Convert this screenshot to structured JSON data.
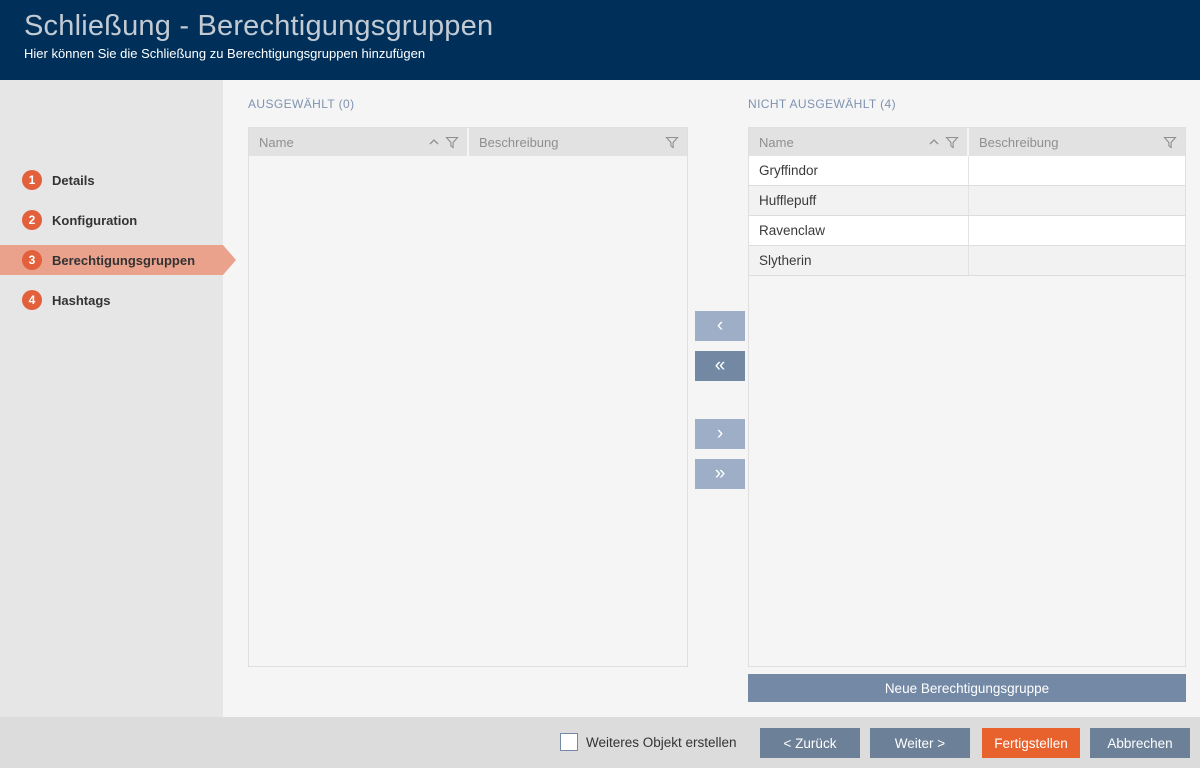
{
  "header": {
    "title": "Schließung - Berechtigungsgruppen",
    "subtitle": "Hier können Sie die Schließung zu Berechtigungsgruppen hinzufügen"
  },
  "sidebar": {
    "items": [
      {
        "number": "1",
        "label": "Details",
        "active": false
      },
      {
        "number": "2",
        "label": "Konfiguration",
        "active": false
      },
      {
        "number": "3",
        "label": "Berechtigungsgruppen",
        "active": true
      },
      {
        "number": "4",
        "label": "Hashtags",
        "active": false
      }
    ]
  },
  "selected_panel": {
    "title": "AUSGEWÄHLT (0)",
    "columns": {
      "name": "Name",
      "description": "Beschreibung"
    },
    "rows": []
  },
  "unselected_panel": {
    "title": "NICHT AUSGEWÄHLT (4)",
    "columns": {
      "name": "Name",
      "description": "Beschreibung"
    },
    "rows": [
      {
        "name": "Gryffindor",
        "beschreibung": ""
      },
      {
        "name": "Hufflepuff",
        "beschreibung": ""
      },
      {
        "name": "Ravenclaw",
        "beschreibung": ""
      },
      {
        "name": "Slytherin",
        "beschreibung": ""
      }
    ],
    "new_group_button": "Neue Berechtigungsgruppe"
  },
  "transfer": {
    "move_left_glyph": "‹",
    "move_all_left_glyph": "«",
    "move_right_glyph": "›",
    "move_all_right_glyph": "»"
  },
  "footer": {
    "checkbox_label": "Weiteres Objekt erstellen",
    "checkbox_checked": false,
    "back_label": "< Zurück",
    "next_label": "Weiter >",
    "finish_label": "Fertigstellen",
    "cancel_label": "Abbrechen"
  },
  "colors": {
    "header_bg": "#00305A",
    "title_text": "#C2CAD3",
    "sidebar_bg": "#E6E6E6",
    "content_bg": "#F5F5F5",
    "footer_bg": "#DCDCDC",
    "step_circle": "#E2603B",
    "active_step_bg": "#EAA28D",
    "accent_orange": "#E8622D",
    "button_blue": "#6C8098",
    "new_group_btn": "#7389A6",
    "transfer_light": "#9DAEC6",
    "transfer_dark": "#7288A3",
    "table_header_bg": "#E2E2E2",
    "panel_title": "#7E93B0"
  }
}
